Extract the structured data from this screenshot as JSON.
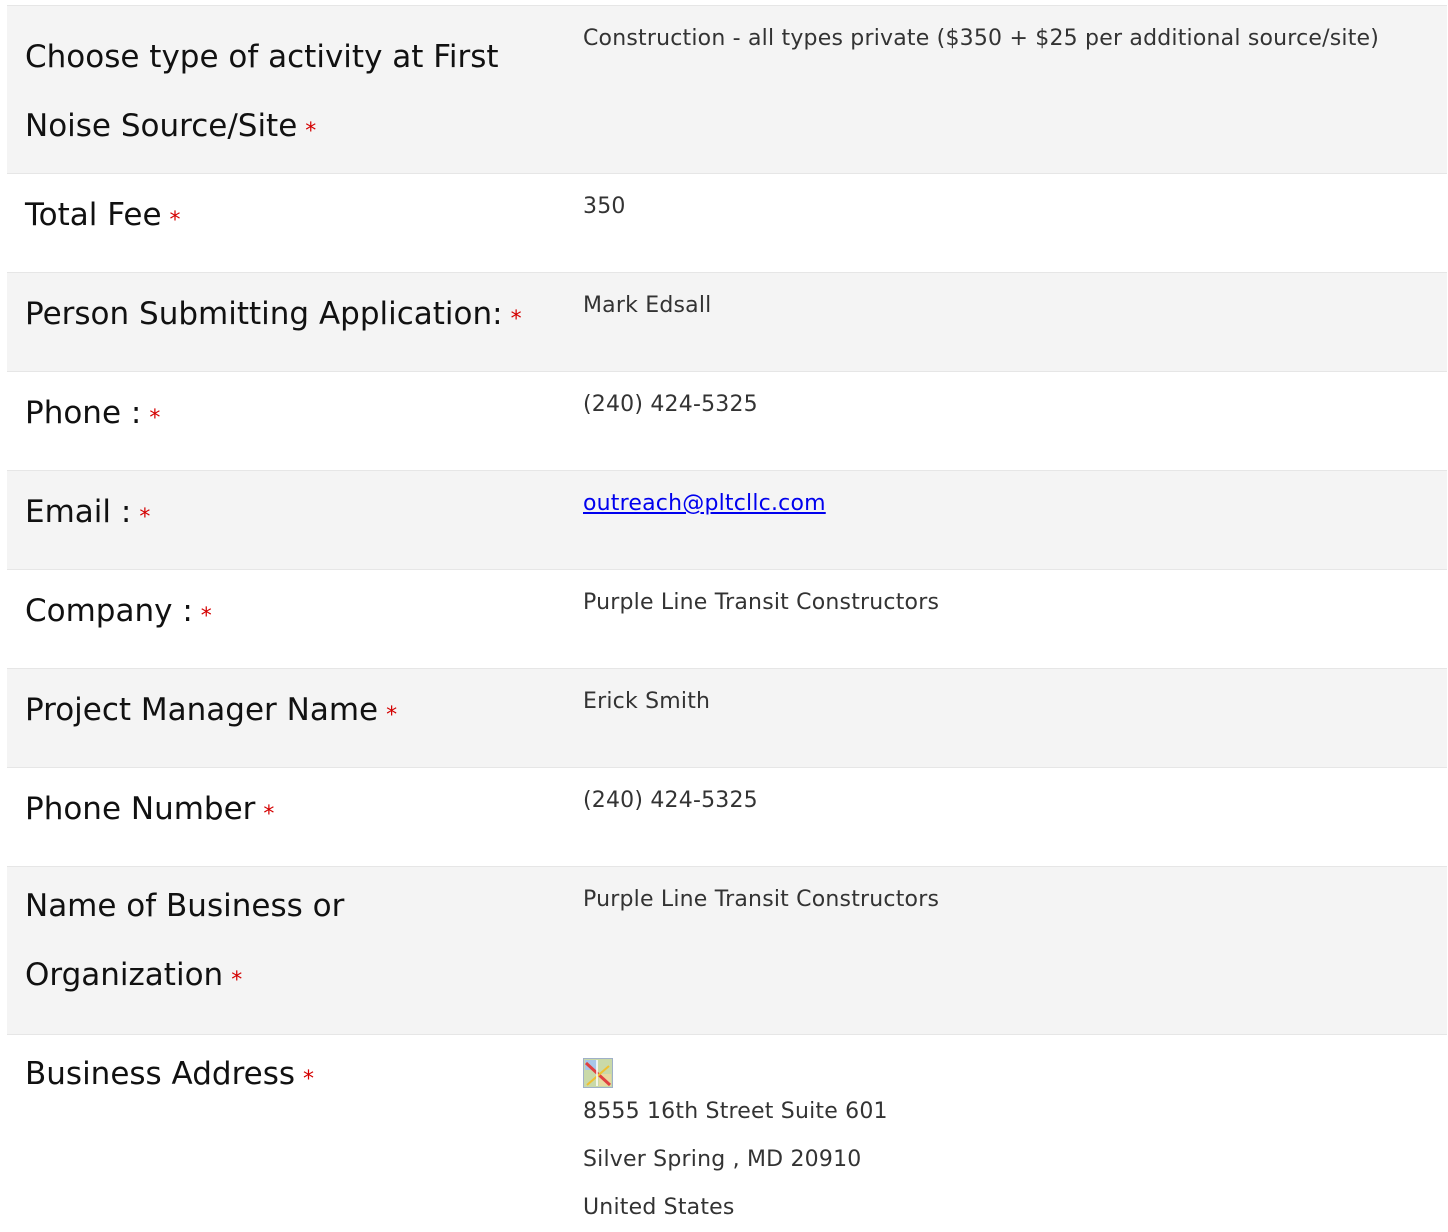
{
  "rows": [
    {
      "label_lines": [
        "Choose type of activity at First",
        "Noise Source/Site"
      ],
      "value": "Construction - all types private ($350 + $25 per additional source/site)"
    },
    {
      "label": "Total Fee",
      "value": "350"
    },
    {
      "label": "Person Submitting Application:",
      "value": "Mark Edsall"
    },
    {
      "label": "Phone :",
      "value": "(240) 424-5325"
    },
    {
      "label": "Email :",
      "value": "outreach@pltcllc.com "
    },
    {
      "label": "Company :",
      "value": "Purple Line Transit Constructors"
    },
    {
      "label": "Project Manager Name",
      "value": "Erick Smith"
    },
    {
      "label": "Phone Number",
      "value": "(240) 424-5325"
    },
    {
      "label_lines": [
        "Name of Business or",
        "Organization"
      ],
      "value": "Purple Line Transit Constructors"
    },
    {
      "label": "Business Address",
      "map_icon": "map-icon",
      "address_lines": [
        "8555 16th Street Suite 601",
        "Silver Spring , MD 20910",
        "United States"
      ]
    }
  ],
  "required_marker": "*",
  "colors": {
    "shaded_row": "#f4f4f4",
    "required": "#d40000",
    "link": "#0000ee"
  }
}
